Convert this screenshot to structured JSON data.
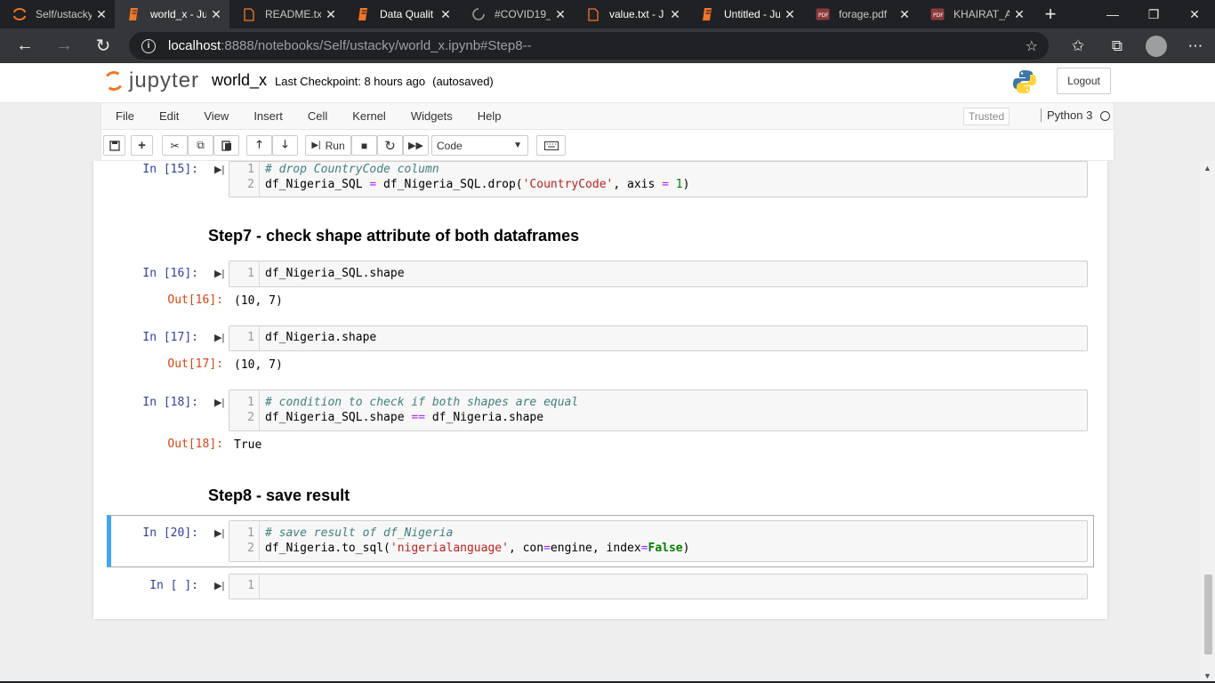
{
  "browser": {
    "tabs": [
      {
        "title": "Self/ustacky",
        "icon": "jupyter-icon",
        "active": false
      },
      {
        "title": "world_x - Ju",
        "icon": "notebook-icon",
        "active": true
      },
      {
        "title": "README.txt",
        "icon": "file-icon",
        "active": false
      },
      {
        "title": "Data Qualit",
        "icon": "notebook-icon",
        "active": false
      },
      {
        "title": "#COVID19_",
        "icon": "loading-icon",
        "active": false
      },
      {
        "title": "value.txt - J",
        "icon": "file-icon",
        "active": false
      },
      {
        "title": "Untitled - Ju",
        "icon": "notebook-icon",
        "active": false
      },
      {
        "title": "forage.pdf",
        "icon": "pdf-icon",
        "active": false
      },
      {
        "title": "KHAIRAT_A",
        "icon": "pdf-icon",
        "active": false
      }
    ],
    "url_host": "localhost",
    "url_rest": ":8888/notebooks/Self/ustacky/world_x.ipynb#Step8--"
  },
  "jupyter": {
    "logo_text": "jupyter",
    "notebook_name": "world_x",
    "checkpoint": "Last Checkpoint: 8 hours ago",
    "autosave": "(autosaved)",
    "logout_label": "Logout",
    "menu": [
      "File",
      "Edit",
      "View",
      "Insert",
      "Cell",
      "Kernel",
      "Widgets",
      "Help"
    ],
    "trusted_label": "Trusted",
    "kernel_name": "Python 3",
    "toolbar": {
      "run_label": "Run",
      "cell_type": "Code"
    }
  },
  "cells": [
    {
      "prompt": "In [15]:",
      "lines": [
        "1",
        "2"
      ]
    },
    {
      "heading": "Step7 - check shape attribute of both dataframes"
    },
    {
      "prompt": "In [16]:",
      "code": "df_Nigeria_SQL.shape",
      "out_prompt": "Out[16]:",
      "output": "(10, 7)"
    },
    {
      "prompt": "In [17]:",
      "code": "df_Nigeria.shape",
      "out_prompt": "Out[17]:",
      "output": "(10, 7)"
    },
    {
      "prompt": "In [18]:",
      "out_prompt": "Out[18]:",
      "output": "True"
    },
    {
      "heading": "Step8 - save result"
    },
    {
      "prompt": "In [20]:"
    },
    {
      "prompt": "In [ ]:"
    }
  ],
  "code": {
    "c15_l1": "# drop CountryCode column",
    "c15_l2_a": "df_Nigeria_SQL ",
    "c15_l2_op": "=",
    "c15_l2_b": " df_Nigeria_SQL.drop(",
    "c15_l2_str": "'CountryCode'",
    "c15_l2_c": ", axis ",
    "c15_l2_op2": "=",
    "c15_l2_num": " 1",
    "c15_l2_d": ")",
    "c18_l1": "# condition to check if both shapes are equal",
    "c18_l2_a": "df_Nigeria_SQL.shape ",
    "c18_l2_op": "==",
    "c18_l2_b": " df_Nigeria.shape",
    "c20_l1": "# save result of df_Nigeria",
    "c20_l2_a": "df_Nigeria.to_sql(",
    "c20_l2_str": "'nigerialanguage'",
    "c20_l2_b": ", con",
    "c20_l2_op": "=",
    "c20_l2_c": "engine, index",
    "c20_l2_op2": "=",
    "c20_l2_kw": "False",
    "c20_l2_d": ")"
  },
  "colors": {
    "accent_blue": "#42a5f5",
    "prompt_in": "#303f9f",
    "prompt_out": "#d84315",
    "jupyter_orange": "#f37626"
  }
}
